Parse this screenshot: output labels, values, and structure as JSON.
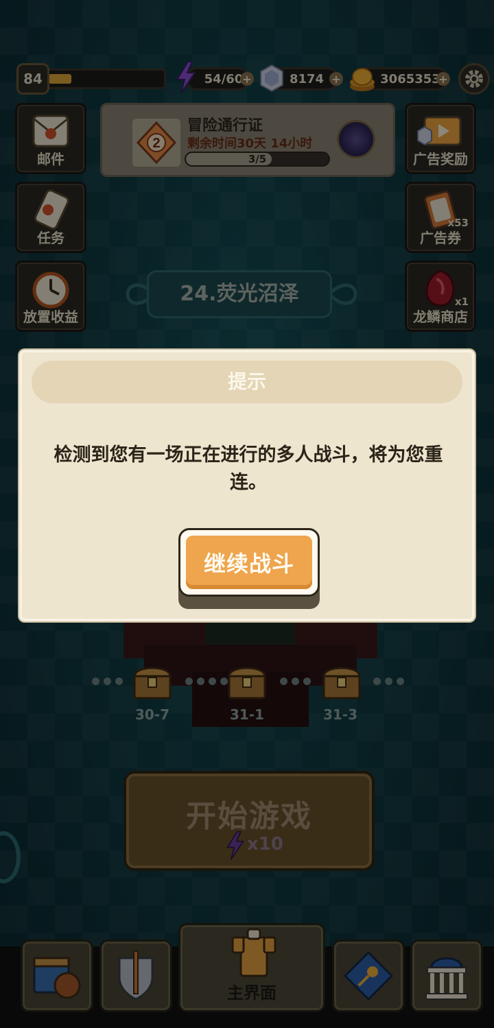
{
  "hud": {
    "player_level": "84",
    "xp_fraction": 0.2,
    "energy": "54/60",
    "gems": "8174",
    "gold": "3065353"
  },
  "left_menu": [
    {
      "label": "邮件",
      "icon": "mail-icon"
    },
    {
      "label": "任务",
      "icon": "scroll-icon"
    },
    {
      "label": "放置收益",
      "icon": "clock-icon"
    }
  ],
  "right_menu": [
    {
      "label": "广告奖励",
      "icon": "tv-ad-icon"
    },
    {
      "label": "广告券",
      "icon": "ad-ticket-icon",
      "count": "x53"
    },
    {
      "label": "龙鳞商店",
      "icon": "dragon-scale-icon",
      "count": "x1"
    }
  ],
  "pass": {
    "rank": "2",
    "title": "冒险通行证",
    "time_left": "剩余时间30天 14小时",
    "progress": "3/5",
    "progress_fraction": 0.6
  },
  "stage": {
    "name": "24.荧光沼泽"
  },
  "chests": [
    {
      "label": "30-7"
    },
    {
      "label": "31-1"
    },
    {
      "label": "31-3"
    }
  ],
  "start": {
    "label": "开始游戏",
    "cost": "x10"
  },
  "nav": {
    "main_label": "主界面"
  },
  "dialog": {
    "title": "提示",
    "message": "检测到您有一场正在进行的多人战斗，将为您重连。",
    "button": "继续战斗"
  },
  "colors": {
    "accent_orange": "#eea54d",
    "dialog_bg": "#eee5cf",
    "energy_purple": "#8a4fd6",
    "gold": "#e0a83a"
  }
}
